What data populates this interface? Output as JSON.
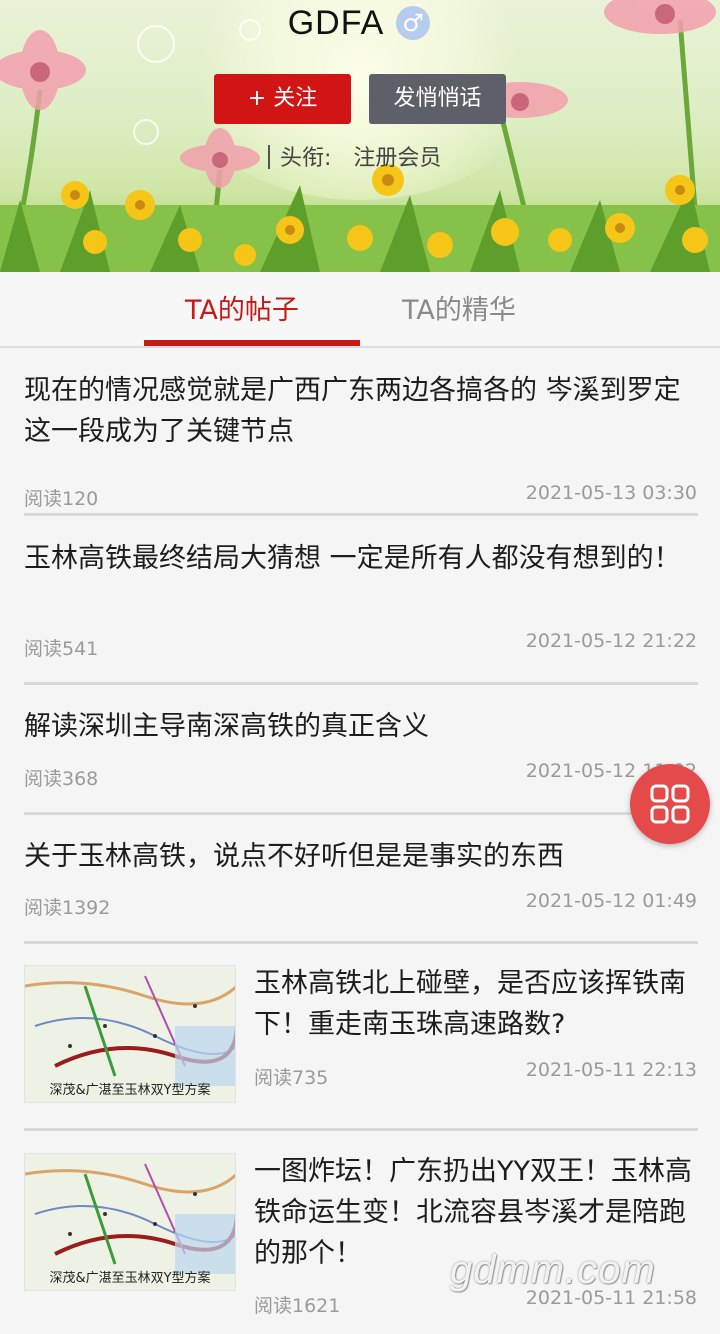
{
  "profile": {
    "name": "GDFA",
    "gender_icon": "male-icon",
    "gender_symbol": "♂",
    "follow_label": "+ 关注",
    "message_label": "发悄悄话",
    "title_label": "头衔:",
    "title_value": "注册会员"
  },
  "tabs": [
    {
      "label": "TA的帖子",
      "active": true
    },
    {
      "label": "TA的精华",
      "active": false
    }
  ],
  "posts": [
    {
      "title": "现在的情况感觉就是广西广东两边各搞各的 岑溪到罗定这一段成为了关键节点",
      "reads": "阅读120",
      "time": "2021-05-13 03:30"
    },
    {
      "title": "玉林高铁最终结局大猜想 一定是所有人都没有想到的！",
      "reads": "阅读541",
      "time": "2021-05-12 21:22"
    },
    {
      "title": "解读深圳主导南深高铁的真正含义",
      "reads": "阅读368",
      "time": "2021-05-12 11:02"
    },
    {
      "title": "关于玉林高铁，说点不好听但是是事实的东西",
      "reads": "阅读1392",
      "time": "2021-05-12 01:49"
    },
    {
      "title": "玉林高铁北上碰壁，是否应该挥铁南下！重走南玉珠高速路数?",
      "reads": "阅读735",
      "time": "2021-05-11 22:13",
      "thumb_caption": "深茂&广湛至玉林双Y型方案"
    },
    {
      "title": "一图炸坛！广东扔出YY双王！玉林高铁命运生变！北流容县岑溪才是陪跑的那个！",
      "reads": "阅读1621",
      "time": "2021-05-11 21:58",
      "thumb_caption": "深茂&广湛至玉林双Y型方案"
    }
  ],
  "fab_icon": "grid-menu-icon",
  "watermark": "gdmm.com",
  "colors": {
    "accent": "#c41a1a",
    "follow_button": "#d11414",
    "message_button": "#5d6069",
    "fab": "#e44a4a"
  }
}
